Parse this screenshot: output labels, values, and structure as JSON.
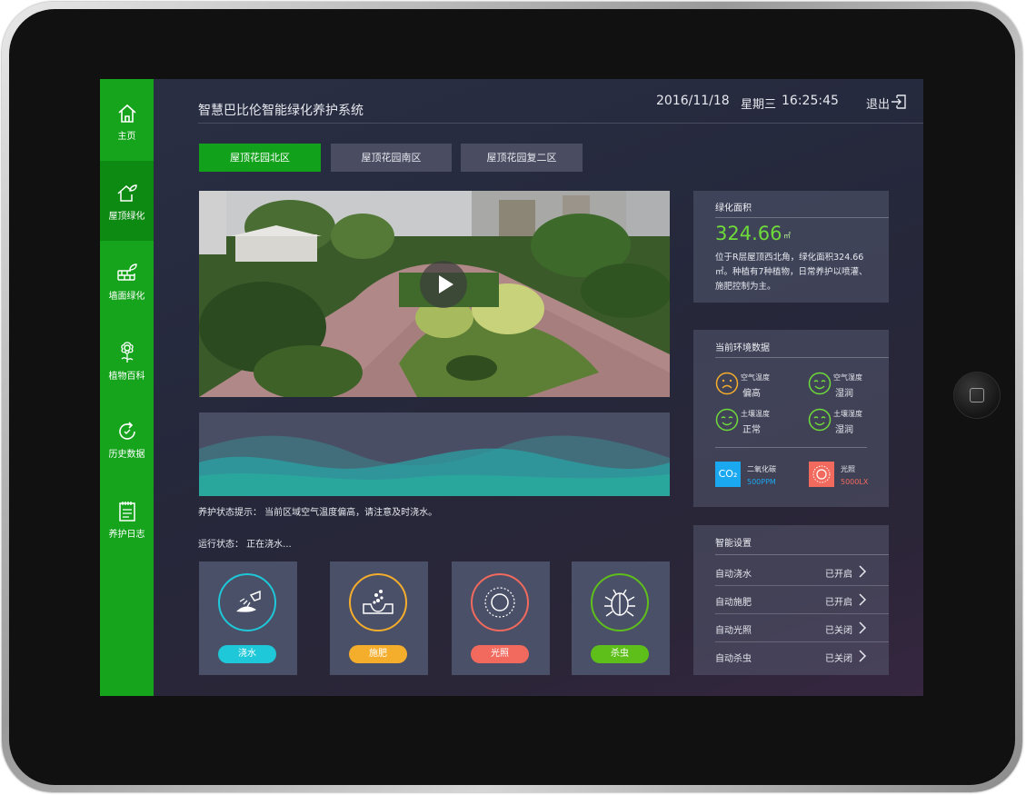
{
  "app": {
    "title": "智慧巴比伦智能绿化养护系统"
  },
  "header": {
    "date": "2016/11/18",
    "weekday": "星期三",
    "time": "16:25:45",
    "logout_label": "退出"
  },
  "sidebar": {
    "items": [
      {
        "label": "主页",
        "icon": "home-icon"
      },
      {
        "label": "屋顶绿化",
        "icon": "roof-plant-icon"
      },
      {
        "label": "墙面绿化",
        "icon": "wall-plant-icon"
      },
      {
        "label": "植物百科",
        "icon": "flower-icon"
      },
      {
        "label": "历史数据",
        "icon": "refresh-icon"
      },
      {
        "label": "养护日志",
        "icon": "notebook-icon"
      }
    ],
    "active_index": 1
  },
  "tabs": [
    {
      "label": "屋顶花园北区",
      "active": true
    },
    {
      "label": "屋顶花园南区",
      "active": false
    },
    {
      "label": "屋顶花园复二区",
      "active": false
    }
  ],
  "main": {
    "status_tip": "养护状态提示：  当前区域空气温度偏高，请注意及时浇水。",
    "run_status": "运行状态：  正在浇水..."
  },
  "actions": [
    {
      "label": "浇水",
      "icon": "watering-icon",
      "color": "#1ec8d8"
    },
    {
      "label": "施肥",
      "icon": "fertilize-icon",
      "color": "#f5ad2c"
    },
    {
      "label": "光照",
      "icon": "sun-icon",
      "color": "#f26a5e"
    },
    {
      "label": "杀虫",
      "icon": "bug-icon",
      "color": "#5fbf1a"
    }
  ],
  "area": {
    "title": "绿化面积",
    "value": "324.66",
    "unit": "㎡",
    "desc": "位于R层屋顶西北角，绿化面积324.66㎡。种植有7种植物，日常养护以喷灌、施肥控制为主。"
  },
  "env": {
    "title": "当前环境数据",
    "items": [
      {
        "name": "空气温度",
        "status": "偏高",
        "mood": "sad",
        "color": "#f5ad2c"
      },
      {
        "name": "空气湿度",
        "status": "湿润",
        "mood": "happy",
        "color": "#6edb3a"
      },
      {
        "name": "土壤温度",
        "status": "正常",
        "mood": "happy",
        "color": "#6edb3a"
      },
      {
        "name": "土壤湿度",
        "status": "湿润",
        "mood": "happy",
        "color": "#6edb3a"
      }
    ],
    "co2": {
      "icon_text": "CO₂",
      "name": "二氧化碳",
      "value": "500PPM",
      "color": "#1aa8f0"
    },
    "light": {
      "name": "光照",
      "value": "5000LX",
      "color": "#f26a5e"
    }
  },
  "settings": {
    "title": "智能设置",
    "items": [
      {
        "name": "自动浇水",
        "state": "已开启"
      },
      {
        "name": "自动施肥",
        "state": "已开启"
      },
      {
        "name": "自动光照",
        "state": "已关闭"
      },
      {
        "name": "自动杀虫",
        "state": "已关闭"
      }
    ]
  }
}
